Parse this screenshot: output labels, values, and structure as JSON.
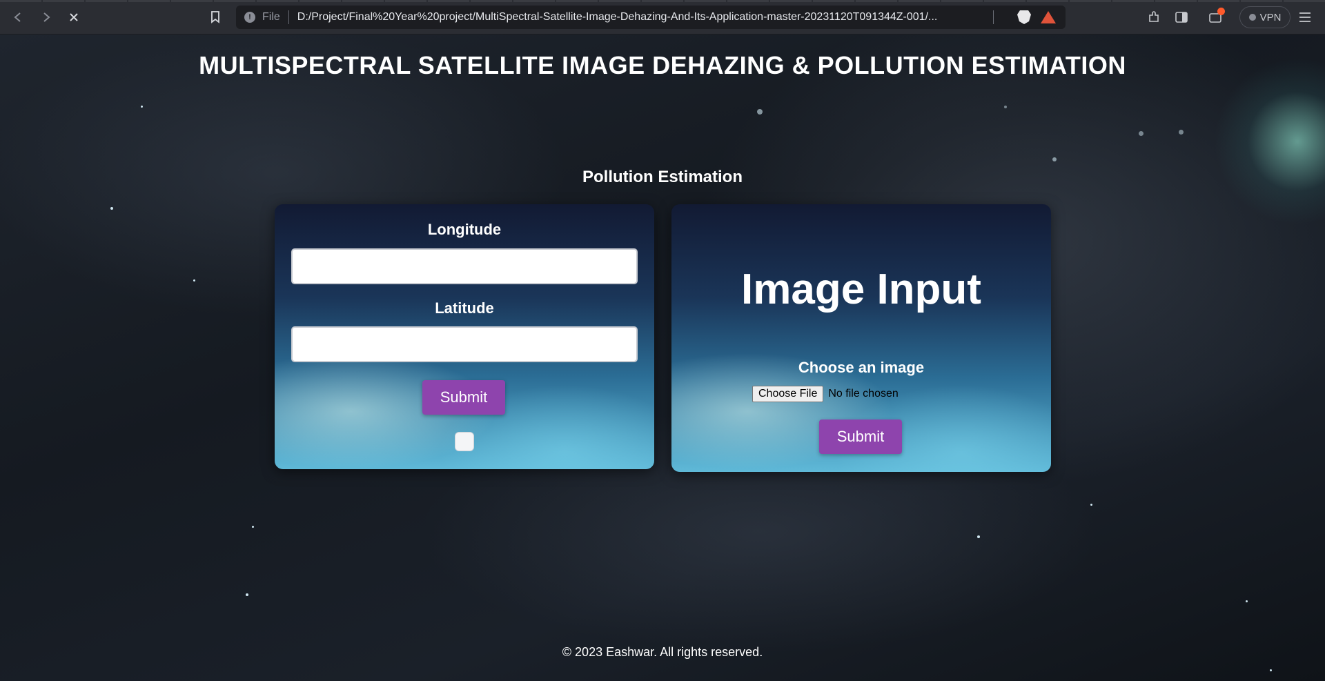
{
  "browser": {
    "address_scheme": "File",
    "url": "D:/Project/Final%20Year%20project/MultiSpectral-Satellite-Image-Dehazing-And-Its-Application-master-20231120T091344Z-001/...",
    "vpn_label": "VPN"
  },
  "page": {
    "title": "MULTISPECTRAL SATELLITE IMAGE DEHAZING & POLLUTION ESTIMATION",
    "section_title": "Pollution Estimation"
  },
  "coords_form": {
    "longitude_label": "Longitude",
    "longitude_value": "",
    "latitude_label": "Latitude",
    "latitude_value": "",
    "submit_label": "Submit",
    "checkbox_checked": false
  },
  "image_form": {
    "heading": "Image Input",
    "choose_label": "Choose an image",
    "file_button_label": "Choose File",
    "file_status": "No file chosen",
    "submit_label": "Submit"
  },
  "footer": {
    "text": "© 2023 Eashwar. All rights reserved."
  },
  "colors": {
    "accent_button": "#8e44ad",
    "brave_warning": "#e0533a",
    "notification": "#ff5a2b"
  },
  "icons": [
    "back-icon",
    "forward-icon",
    "stop-loading-icon",
    "bookmark-icon",
    "site-info-icon",
    "brave-shields-icon",
    "brave-rewards-icon",
    "extensions-icon",
    "sidebar-icon",
    "wallet-icon",
    "menu-icon"
  ]
}
